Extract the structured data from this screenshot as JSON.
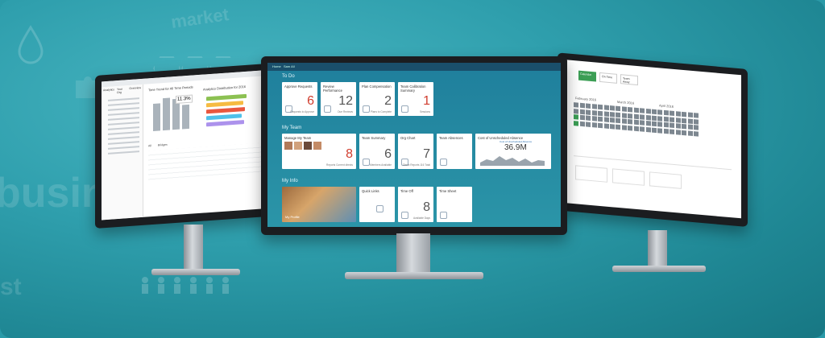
{
  "background": {
    "words": [
      "market",
      "busine",
      "st"
    ],
    "accent_color": "#2f9fad"
  },
  "center": {
    "topbar": [
      "Home",
      "Sam All"
    ],
    "sections": {
      "todo": "To Do",
      "my_team": "My Team",
      "my_info": "My Info"
    },
    "todo_tiles": [
      {
        "title": "Approve Requests",
        "value": "6",
        "sub": "Requests\nto Approve",
        "accent": "red"
      },
      {
        "title": "Review Performance",
        "value": "12",
        "sub": "Due Reviews",
        "accent": "gray"
      },
      {
        "title": "Plan Compensation",
        "value": "2",
        "sub": "Plans to\nComplete",
        "accent": "gray"
      },
      {
        "title": "Team Calibration Summary",
        "value": "1",
        "sub": "Sessions",
        "accent": "red"
      }
    ],
    "team_tiles": [
      {
        "title": "Manage My Team",
        "value": "8",
        "sub": "Reports\nCurrent directs"
      },
      {
        "title": "Team Summary",
        "value": "6",
        "sub": "Members Available"
      },
      {
        "title": "Org Chart",
        "value": "7",
        "sub": "Direct Reports\n116 Total"
      },
      {
        "title": "Team Absences",
        "value": "",
        "sub": ""
      }
    ],
    "cost_tile": {
      "title": "Cost of Unscheduled Absence",
      "subtitle": "Cost of Unscheduled Absence",
      "value": "36.9M"
    },
    "info_tiles": [
      {
        "title": "My Profile",
        "value": "",
        "sub": ""
      },
      {
        "title": "Quick Links",
        "value": "",
        "sub": ""
      },
      {
        "title": "Time Off",
        "value": "8",
        "sub": "Available\nDays"
      },
      {
        "title": "Time Sheet",
        "value": "",
        "sub": ""
      }
    ]
  },
  "left": {
    "tabs": [
      "Analytics",
      "Your Org",
      "Overview"
    ],
    "chart_title": "Time Trend for All Time Periods",
    "dist_title": "Analytics Distribution for 2016",
    "callout": "11.3%",
    "table_labels": [
      "All",
      "Bridges"
    ]
  },
  "right": {
    "tabs": [
      "Calendar",
      "On Time",
      "Team Away"
    ],
    "months": [
      "February 2016",
      "March 2016",
      "April 2016"
    ]
  }
}
